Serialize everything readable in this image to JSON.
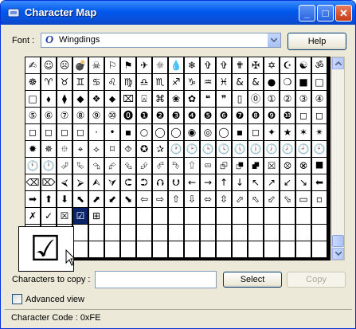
{
  "window": {
    "title": "Character Map"
  },
  "font_row": {
    "label": "Font :",
    "selected_font": "Wingdings",
    "help_label": "Help"
  },
  "grid": {
    "rows": [
      [
        "✍",
        "☺",
        "☹",
        "💣",
        "☠",
        "⚐",
        "⚑",
        "✈",
        "☼",
        "💧",
        "❄",
        "✞",
        "✞",
        "✟",
        "✠",
        "✡",
        "☪",
        "☯",
        "ॐ"
      ],
      [
        "☸",
        "♈",
        "♉",
        "♊",
        "♋",
        "♌",
        "♍",
        "♎",
        "♏",
        "♐",
        "♑",
        "♒",
        "♓",
        "&",
        "&",
        "●",
        "❍",
        "■",
        "□"
      ],
      [
        "□",
        "⬧",
        "⧫",
        "◆",
        "❖",
        "⬥",
        "⌧",
        "⍓",
        "⌘",
        "❀",
        "✿",
        "❝",
        "❞",
        "▯",
        "⓪",
        "①",
        "②",
        "③",
        "④"
      ],
      [
        "⑤",
        "⑥",
        "⑦",
        "⑧",
        "⑨",
        "⑩",
        "⓿",
        "❶",
        "❷",
        "❸",
        "❹",
        "❺",
        "❻",
        "❼",
        "❽",
        "❾",
        "❿",
        "◻",
        "◻"
      ],
      [
        "◻",
        "◻",
        "◻",
        "◻",
        "·",
        "•",
        "▪",
        "○",
        "◯",
        "◯",
        "◉",
        "◎",
        "◯",
        "▪",
        "◻",
        "✦",
        "★",
        "✶",
        "✴"
      ],
      [
        "✹",
        "✵",
        "⯐",
        "⌖",
        "⟡",
        "⌑",
        "⯑",
        "✪",
        "✰",
        "🕐",
        "🕑",
        "🕒",
        "🕓",
        "🕔",
        "🕕",
        "🕖",
        "🕗",
        "🕘",
        "🕙"
      ],
      [
        "🕚",
        "🕛",
        "⮰",
        "⮱",
        "⮲",
        "⮳",
        "⮴",
        "⮵",
        "⮶",
        "⮷",
        "⮸",
        "⮹",
        "⮺",
        "⮻",
        "⮼",
        "⮽",
        "⮾",
        "⮿",
        "⯀"
      ],
      [
        "⌫",
        "⌦",
        "⮘",
        "⮚",
        "⮙",
        "⮛",
        "⮈",
        "⮊",
        "⮉",
        "⮋",
        "←",
        "→",
        "↑",
        "↓",
        "↖",
        "↗",
        "↙",
        "↘",
        "⬅"
      ],
      [
        "➡",
        "⬆",
        "⬇",
        "⬉",
        "⬈",
        "⬋",
        "⬊",
        "⇦",
        "⇨",
        "⇧",
        "⇩",
        "⬄",
        "⇳",
        "⬀",
        "⬁",
        "⬃",
        "⬂",
        "▭",
        "▫"
      ],
      [
        "✗",
        "✓",
        "☒",
        "☑",
        "⊞",
        "",
        "",
        "",
        "",
        "",
        "",
        "",
        "",
        "",
        "",
        "",
        "",
        "",
        ""
      ],
      [
        "",
        "",
        "",
        "",
        "",
        "",
        "",
        "",
        "",
        "",
        "",
        "",
        "",
        "",
        "",
        "",
        "",
        "",
        ""
      ],
      [
        "",
        "",
        "",
        "",
        "",
        "",
        "",
        "",
        "",
        "",
        "",
        "",
        "",
        "",
        "",
        "",
        "",
        "",
        ""
      ]
    ],
    "magnified_char": "☑"
  },
  "copy_row": {
    "label": "Characters to copy :",
    "value": "",
    "select_label": "Select",
    "copy_label": "Copy"
  },
  "advanced": {
    "label": "Advanced view",
    "checked": false
  },
  "status": {
    "text": "Character Code : 0xFE"
  },
  "icons": {
    "app": "character-map-icon",
    "font": "opentype-font-icon",
    "dropdown": "chevron-down-icon",
    "magnified": "checked-box-icon",
    "cursor": "mouse-pointer-icon"
  }
}
